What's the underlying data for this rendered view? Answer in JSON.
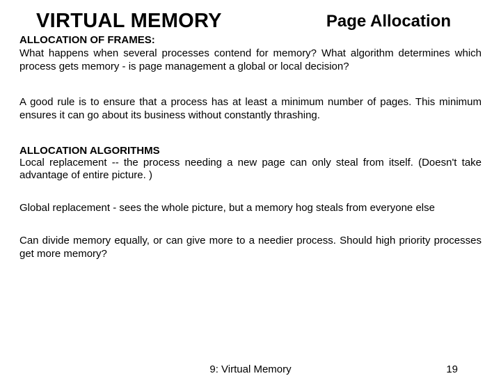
{
  "header": {
    "title_left": "VIRTUAL MEMORY",
    "title_right": "Page Allocation"
  },
  "body": {
    "subhead1": "ALLOCATION OF FRAMES:",
    "para1": "What happens when several processes contend for memory? What algorithm determines which process gets memory - is page management a global or local decision?",
    "para2": "A good rule is to ensure that a process has at least a minimum number of pages. This minimum ensures it can go about its business without constantly thrashing.",
    "subhead2": "ALLOCATION ALGORITHMS",
    "para3": "Local replacement -- the process needing a new page can only steal from itself. (Doesn't take advantage of entire picture. )",
    "para4": "Global replacement - sees the whole picture, but a memory hog steals from everyone else",
    "para5": "Can divide memory equally, or can give more to a needier process. Should high priority processes get more memory?"
  },
  "footer": {
    "center": "9: Virtual Memory",
    "page": "19"
  }
}
